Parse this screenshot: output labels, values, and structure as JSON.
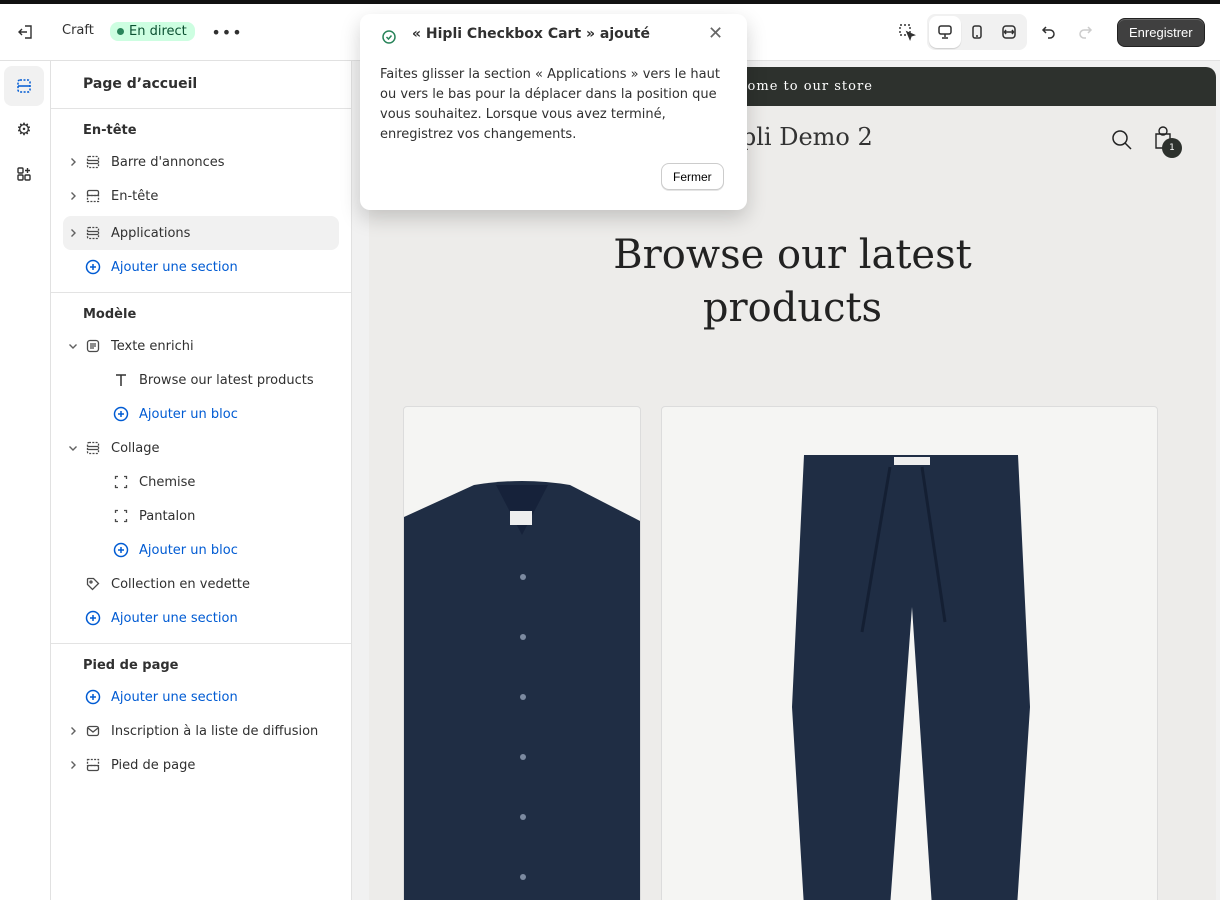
{
  "toolbar": {
    "theme_name": "Craft",
    "status_badge": "En direct",
    "save_label": "Enregistrer"
  },
  "sidebar": {
    "title": "Page d’accueil",
    "groups": [
      {
        "label": "En-tête",
        "items": [
          {
            "label": "Barre d'annonces",
            "icon": "section-icon"
          },
          {
            "label": "En-tête",
            "icon": "header-icon"
          },
          {
            "label": "Applications",
            "icon": "section-icon",
            "selected": true
          },
          {
            "label": "Ajouter une section",
            "icon": "plus-circle-icon"
          }
        ]
      },
      {
        "label": "Modèle",
        "items": [
          {
            "label": "Texte enrichi",
            "icon": "text-block-icon"
          },
          {
            "label": "Browse our latest products",
            "icon": "text-icon"
          },
          {
            "label": "Ajouter un bloc",
            "icon": "plus-circle-icon"
          },
          {
            "label": "Collage",
            "icon": "section-icon"
          },
          {
            "label": "Chemise",
            "icon": "block-icon"
          },
          {
            "label": "Pantalon",
            "icon": "block-icon"
          },
          {
            "label": "Ajouter un bloc",
            "icon": "plus-circle-icon"
          },
          {
            "label": "Collection en vedette",
            "icon": "tag-icon"
          },
          {
            "label": "Ajouter une section",
            "icon": "plus-circle-icon"
          }
        ]
      },
      {
        "label": "Pied de page",
        "items": [
          {
            "label": "Ajouter une section",
            "icon": "plus-circle-icon"
          },
          {
            "label": "Inscription à la liste de diffusion",
            "icon": "email-icon"
          },
          {
            "label": "Pied de page",
            "icon": "footer-icon"
          }
        ]
      }
    ]
  },
  "toast": {
    "title": "« Hipli Checkbox Cart » ajouté",
    "body": "Faites glisser la section « Applications » vers le haut ou vers le bas pour la déplacer dans la position que vous souhaitez. Lorsque vous avez terminé, enregistrez vos changements.",
    "close_label": "Fermer"
  },
  "preview": {
    "announcement": "Welcome to our store",
    "store_name": "Hipli Demo 2",
    "heading": "Browse our latest products",
    "cart_count": "1"
  },
  "colors": {
    "accent": "#005bd3",
    "status": "#29845a",
    "announcement_bg": "#2d312d",
    "product_navy": "#1f2d44"
  }
}
